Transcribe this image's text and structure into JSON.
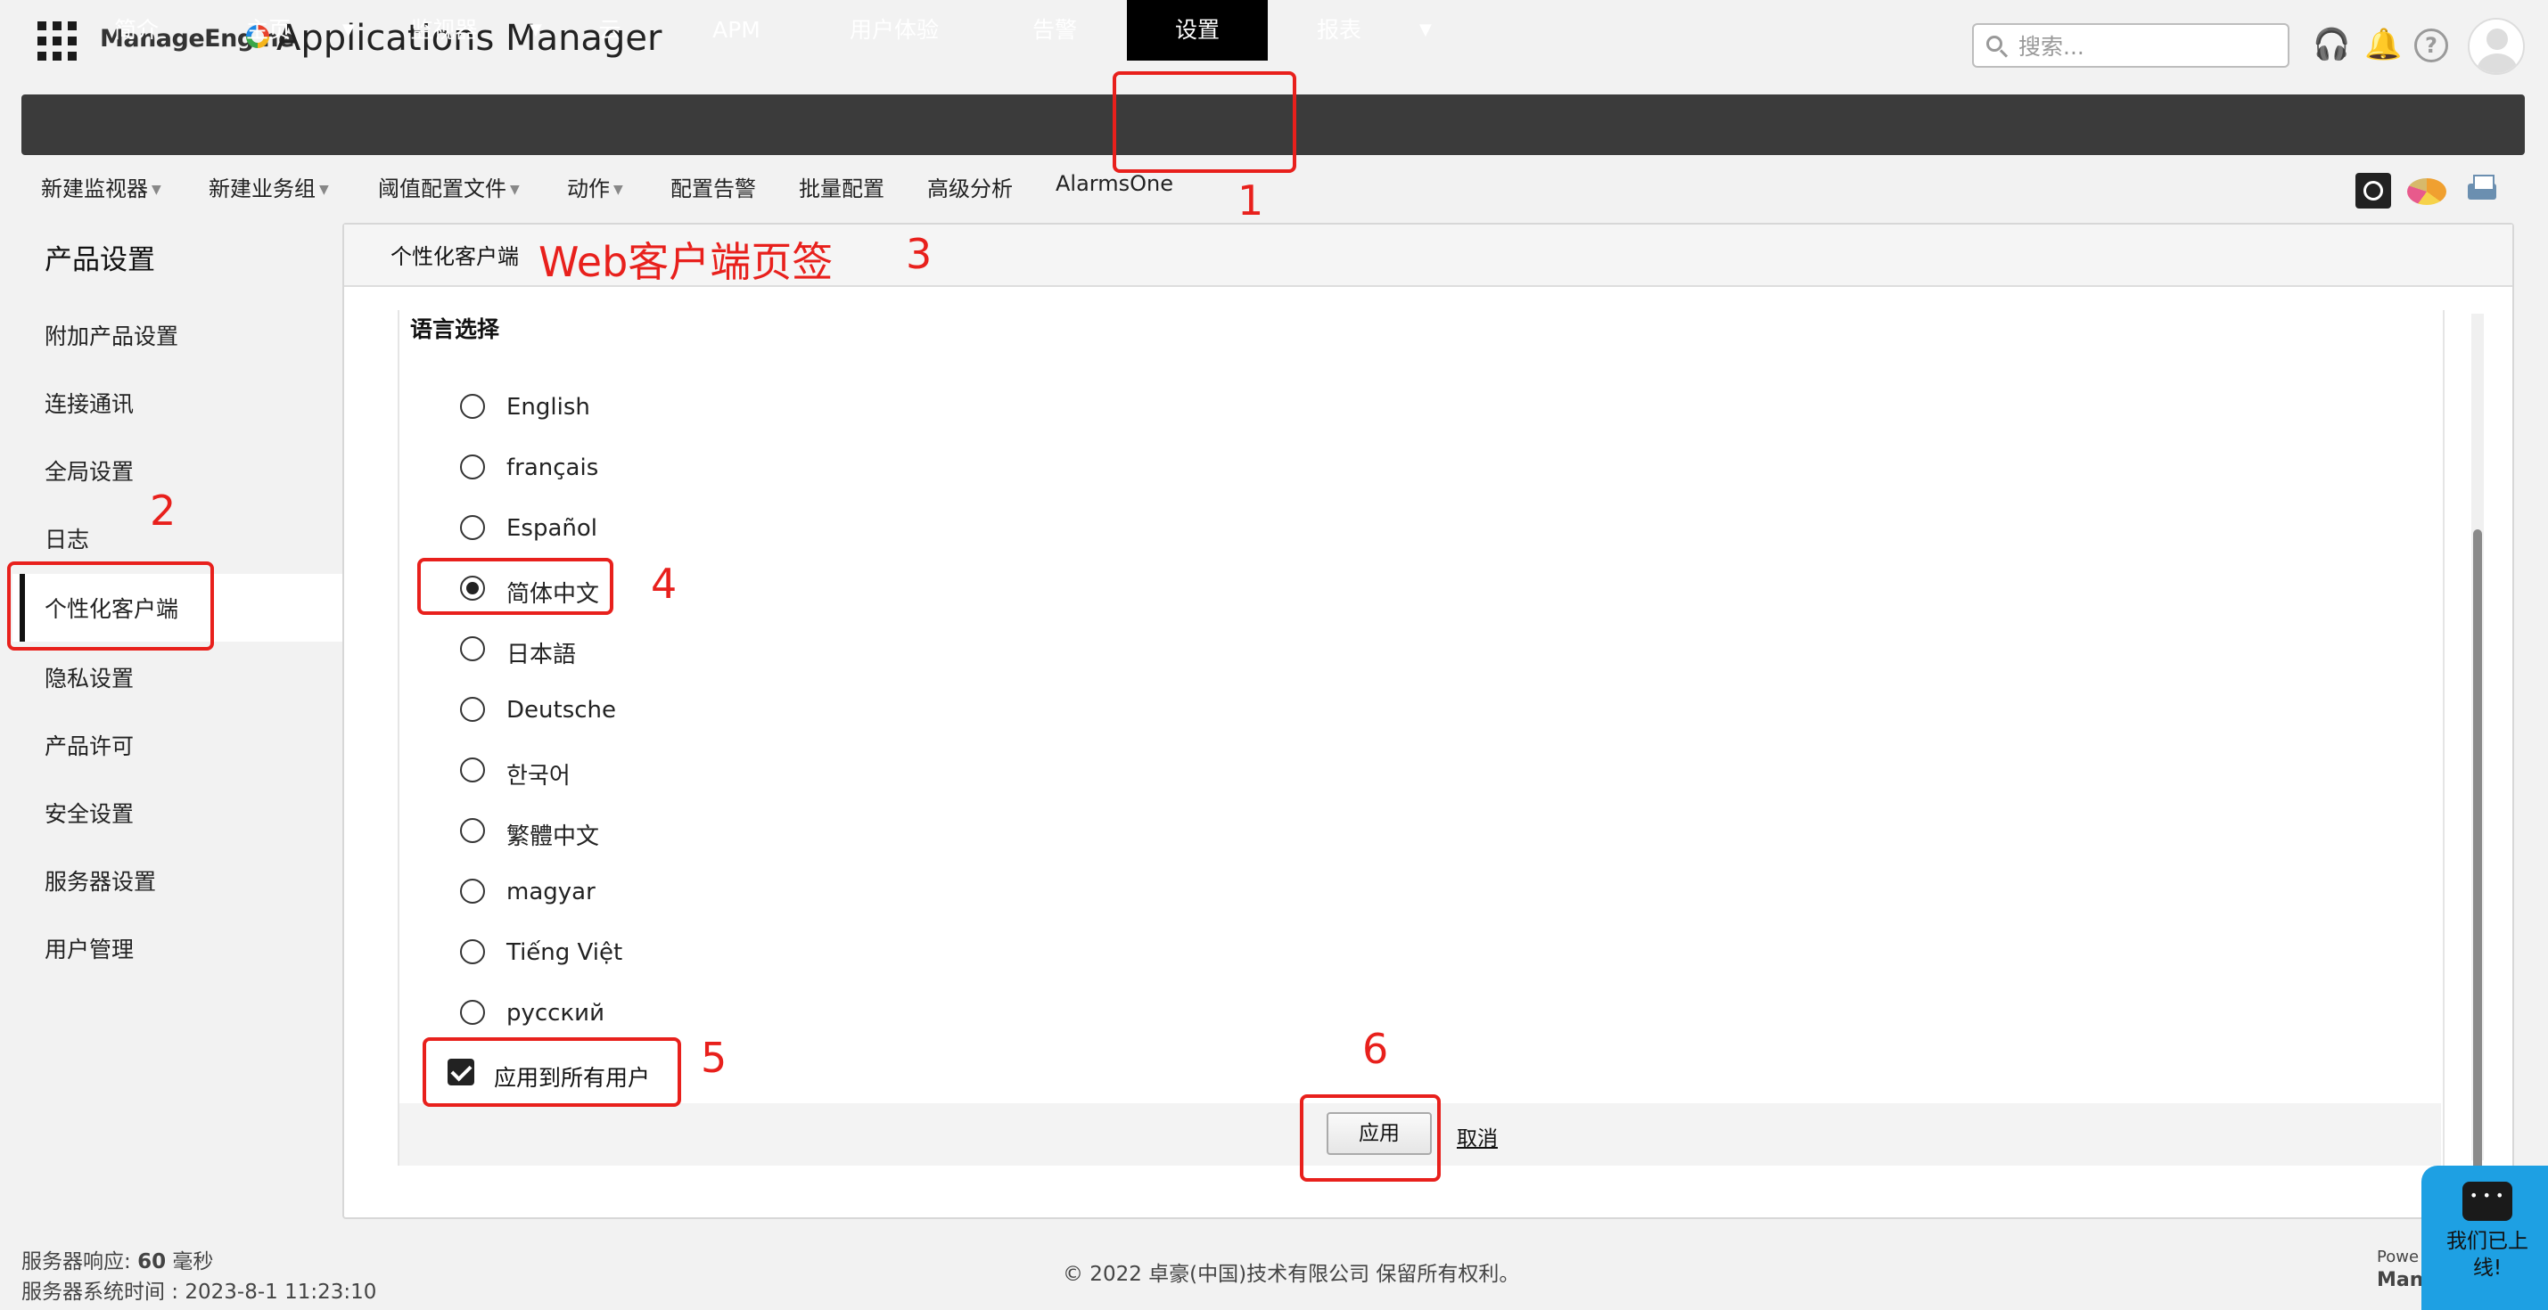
{
  "header": {
    "brand_small": "ManageEngine",
    "brand_large": "Applications Manager",
    "search_placeholder": "搜索..."
  },
  "main_nav": [
    "简介",
    "主页",
    "监视器",
    "云",
    "APM",
    "用户体验",
    "告警",
    "设置",
    "报表"
  ],
  "active_nav": "设置",
  "sub_nav": [
    "新建监视器",
    "新建业务组",
    "阈值配置文件",
    "动作",
    "配置告警",
    "批量配置",
    "高级分析",
    "AlarmsOne"
  ],
  "sidebar": {
    "title": "产品设置",
    "items": [
      "附加产品设置",
      "连接通讯",
      "全局设置",
      "日志",
      "个性化客户端",
      "隐私设置",
      "产品许可",
      "安全设置",
      "服务器设置",
      "用户管理"
    ],
    "active": "个性化客户端"
  },
  "panel": {
    "tab": "个性化客户端",
    "section_title": "语言选择",
    "languages": [
      "English",
      "français",
      "Español",
      "简体中文",
      "日本語",
      "Deutsche",
      "한국어",
      "繁體中文",
      "magyar",
      "Tiếng Việt",
      "русский"
    ],
    "selected_language": "简体中文",
    "apply_all_label": "应用到所有用户",
    "apply_all_checked": true,
    "apply_button": "应用",
    "cancel_link": "取消"
  },
  "annotations": {
    "n1": "1",
    "n2": "2",
    "n3": "3",
    "n4": "4",
    "n5": "5",
    "n6": "6",
    "web_tab_label": "Web客户端页签",
    "color": "#e8201c"
  },
  "footer": {
    "response_label": "服务器响应: ",
    "response_value": "60",
    "response_unit": " 毫秒",
    "time_label": "服务器系统时间 : 2023-8-1 11:23:10",
    "copyright": "© 2022 卓豪(中国)技术有限公司   保留所有权利。",
    "powered": "Powe",
    "powered2": "Mana",
    "chat": "我们已上线!"
  },
  "colors": {
    "nav_bg": "#3b3b3b",
    "nav_active": "#000000",
    "chat_bg": "#1ea0e3"
  }
}
